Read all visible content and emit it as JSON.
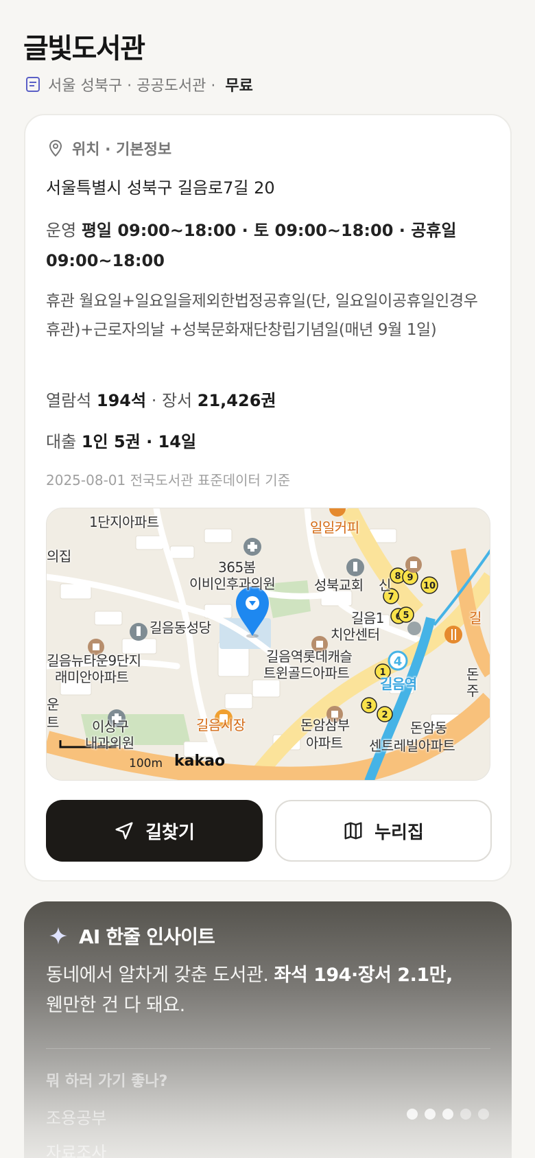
{
  "header": {
    "title": "글빛도서관",
    "meta": "서울 성북구 · 공공도서관 ·",
    "fee": "무료"
  },
  "info": {
    "section_title": "위치 · 기본정보",
    "address": "서울특별시 성북구 길음로7길 20",
    "hours_label": "운영",
    "hours_value": "평일 09:00~18:00 · 토 09:00~18:00 · 공휴일 09:00~18:00",
    "closed_text": "휴관 월요일+일요일을제외한법정공휴일(단, 일요일이공휴일인경우휴관)+근로자의날 +성북문화재단창립기념일(매년 9월 1일)",
    "seats_label": "열람석",
    "seats_value": "194석",
    "books_label": "· 장서",
    "books_value": "21,426권",
    "loan_label": "대출",
    "loan_value": "1인 5권 · 14일",
    "source": "2025-08-01 전국도서관 표준데이터 기준"
  },
  "map": {
    "labels": {
      "apt1": "1단지아파트",
      "uijip": "의집",
      "cafe": "일일커피",
      "clinic365": "365봄",
      "ent": "이비인후과의원",
      "church": "성북교회",
      "shin": "신",
      "center1": "길음1",
      "center2": "치안센터",
      "cathedral": "길음동성당",
      "newtown1": "길음뉴타운9단지",
      "newtown2": "래미안아파트",
      "lotte1": "길음역롯데캐슬",
      "lotte2": "트윈골드아파트",
      "station": "길음역",
      "market": "길음시장",
      "donam1": "돈암삼부",
      "donam2": "아파트",
      "lsang1": "이상구",
      "lsang2": "내과의원",
      "donamdong": "돈암동",
      "central": "센트레빌아파트",
      "un": "운",
      "teu": "트",
      "don": "돈",
      "ju": "주",
      "gil": "길"
    },
    "scale": "100m",
    "brand": "kakao",
    "exit_numbers": [
      "8",
      "9",
      "10",
      "7",
      "6",
      "5",
      "1",
      "3",
      "2"
    ],
    "line_number": "4"
  },
  "buttons": {
    "directions": "길찾기",
    "nurijip": "누리집"
  },
  "ai": {
    "title": "AI 한줄 인사이트",
    "text_plain": "동네에서 알차게 갖춘 도서관. ",
    "text_bold": "좌석 194·장서 2.1만,",
    "text_end": "웬만한 건 다 돼요.",
    "question": "뭐 하러 가기 좋나?",
    "items": [
      "조용공부",
      "자료조사"
    ]
  },
  "colors": {
    "accent": "#1c1a17",
    "pin": "#1e88f0",
    "subway": "#3aa6e0",
    "road": "#f9c87c"
  }
}
